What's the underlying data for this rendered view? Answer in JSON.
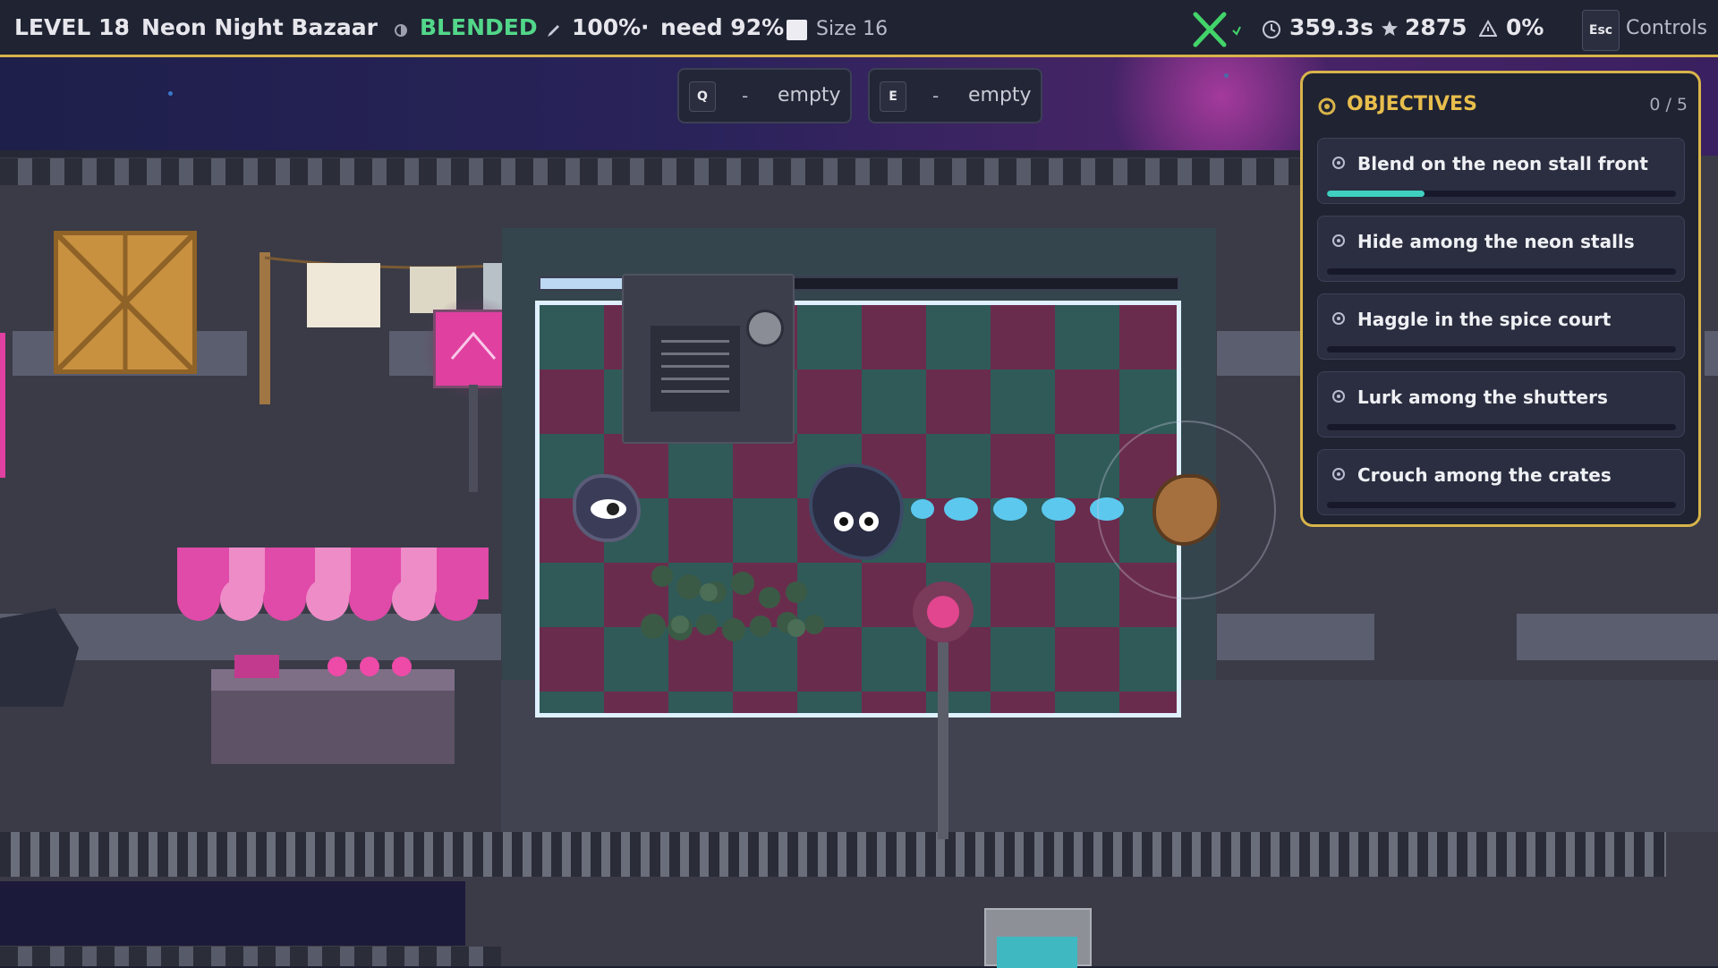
{
  "hud": {
    "level": "LEVEL 18",
    "separator": "·",
    "level_name": "Neon Night Bazaar",
    "status": "BLENDED",
    "blend_percent": "100%",
    "need_separator": "·",
    "need": "need 92%",
    "size": "Size 16",
    "time": "359.3s",
    "score": "2875",
    "alert": "0%",
    "esc_key": "Esc",
    "controls_label": "Controls",
    "status_color": "#52d78a",
    "accent_color": "#d8b44a"
  },
  "abilities": [
    {
      "key": "Q",
      "dash": "-",
      "label": "empty"
    },
    {
      "key": "E",
      "dash": "-",
      "label": "empty"
    }
  ],
  "objectives": {
    "title": "OBJECTIVES",
    "count": "0 / 5",
    "items": [
      {
        "label": "Blend on the neon stall front",
        "progress": 0.28
      },
      {
        "label": "Hide among the neon stalls",
        "progress": 0
      },
      {
        "label": "Haggle in the spice court",
        "progress": 0
      },
      {
        "label": "Lurk among the shutters",
        "progress": 0
      },
      {
        "label": "Crouch among the crates",
        "progress": 0
      }
    ]
  },
  "blend_meter": {
    "progress": 0.34
  },
  "icons": [
    "contrast-icon",
    "brush-icon",
    "square-icon",
    "blade-icon",
    "clock-icon",
    "star-icon",
    "alert-icon",
    "target-icon"
  ]
}
